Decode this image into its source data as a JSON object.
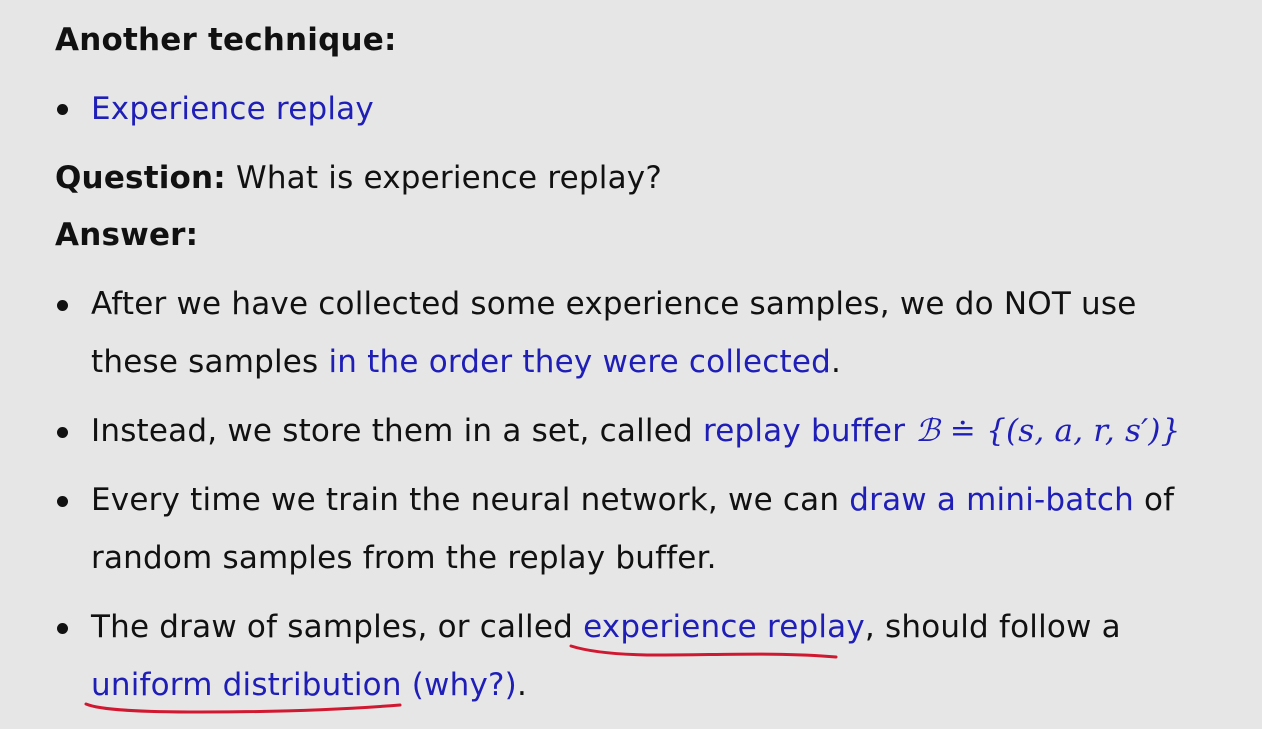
{
  "heading_technique": "Another technique:",
  "item_experience_replay": "Experience replay",
  "question": {
    "label": "Question:",
    "text": " What is experience replay?"
  },
  "answer_label": "Answer:",
  "bullets": {
    "b1": {
      "part1": "After we have collected some experience samples, we do NOT use",
      "part2a": "these samples ",
      "part2b_blue": "in the order they were collected",
      "part2c": "."
    },
    "b2": {
      "part1": "Instead, we store them in a set, called ",
      "blue": "replay buffer",
      "math_B": "ℬ",
      "math_rest": " ≐ {(s, a, r, s′)}"
    },
    "b3": {
      "part1": "Every time we train the neural network, we can ",
      "blue": "draw a mini-batch",
      "part1_end": " of",
      "part2": "random samples from the replay buffer."
    },
    "b4": {
      "part1": "The draw of samples, or called ",
      "blue1": "experience replay",
      "part1_end": ", should follow a",
      "blue2": "uniform distribution",
      "blue3": " (why?)",
      "end": "."
    }
  },
  "colors": {
    "background": "#e6e6e6",
    "text": "#111111",
    "link_blue": "#1f1fb8",
    "annotation_red": "#d01830"
  }
}
